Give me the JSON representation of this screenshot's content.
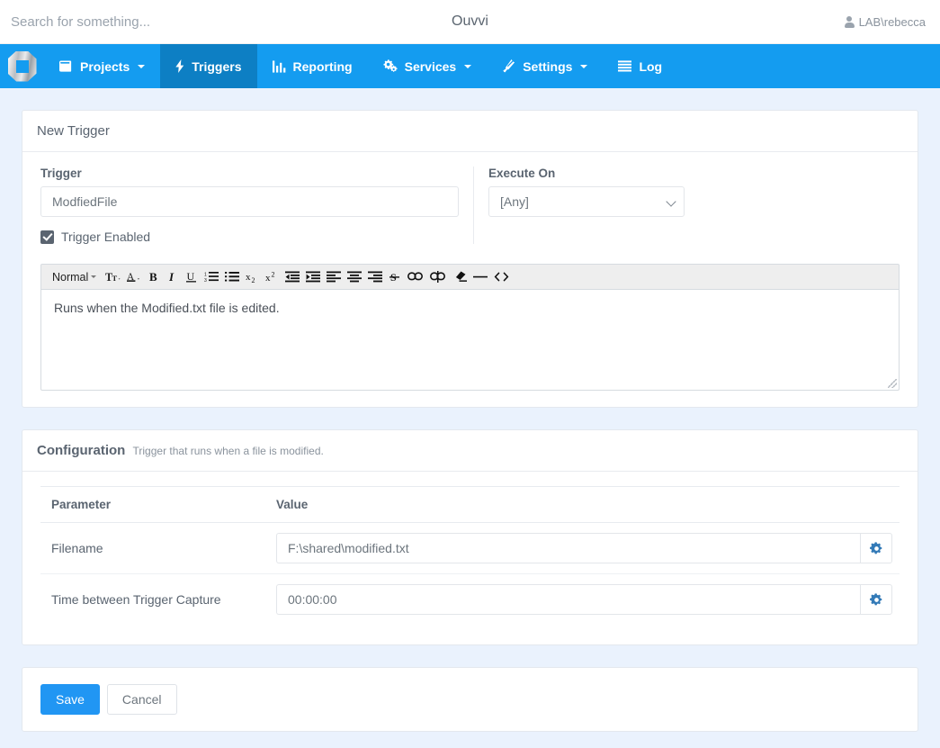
{
  "topbar": {
    "search_placeholder": "Search for something...",
    "search_value": "",
    "app_title": "Ouvvi",
    "user": "LAB\\rebecca"
  },
  "nav": {
    "brand_name": "ouvvi-logo",
    "items": [
      {
        "label": "Projects",
        "icon": "book-icon",
        "caret": true,
        "active": false
      },
      {
        "label": "Triggers",
        "icon": "bolt-icon",
        "caret": false,
        "active": true
      },
      {
        "label": "Reporting",
        "icon": "bar-chart-icon",
        "caret": false,
        "active": false
      },
      {
        "label": "Services",
        "icon": "gears-icon",
        "caret": true,
        "active": false
      },
      {
        "label": "Settings",
        "icon": "wrench-icon",
        "caret": true,
        "active": false
      },
      {
        "label": "Log",
        "icon": "list-icon",
        "caret": false,
        "active": false
      }
    ]
  },
  "trigger_panel": {
    "title": "New Trigger",
    "trigger_label": "Trigger",
    "trigger_value": "ModfiedFile",
    "trigger_placeholder": "",
    "execute_on_label": "Execute On",
    "execute_on_value": "[Any]",
    "execute_on_options": [
      "[Any]"
    ],
    "enabled_label": "Trigger Enabled",
    "enabled_checked": true
  },
  "editor": {
    "format_label": "Normal",
    "content": "Runs when the Modified.txt file is edited.",
    "tools": [
      {
        "name": "font-size-icon",
        "glyph": "Tᴛ"
      },
      {
        "name": "font-color-icon",
        "glyph": "A"
      },
      {
        "name": "bold-icon",
        "glyph": "B"
      },
      {
        "name": "italic-icon",
        "glyph": "I"
      },
      {
        "name": "underline-icon",
        "glyph": "U"
      },
      {
        "name": "ordered-list-icon",
        "glyph": ""
      },
      {
        "name": "unordered-list-icon",
        "glyph": ""
      },
      {
        "name": "subscript-icon",
        "glyph": "x₂"
      },
      {
        "name": "superscript-icon",
        "glyph": "x²"
      },
      {
        "name": "outdent-icon",
        "glyph": ""
      },
      {
        "name": "indent-icon",
        "glyph": ""
      },
      {
        "name": "align-left-icon",
        "glyph": ""
      },
      {
        "name": "align-center-icon",
        "glyph": ""
      },
      {
        "name": "align-right-icon",
        "glyph": ""
      },
      {
        "name": "strikethrough-icon",
        "glyph": "S"
      },
      {
        "name": "link-icon",
        "glyph": ""
      },
      {
        "name": "unlink-icon",
        "glyph": ""
      },
      {
        "name": "clear-format-icon",
        "glyph": ""
      },
      {
        "name": "horizontal-rule-icon",
        "glyph": "—"
      },
      {
        "name": "source-code-icon",
        "glyph": "<>"
      }
    ]
  },
  "configuration": {
    "title": "Configuration",
    "subtitle": "Trigger that runs when a file is modified.",
    "columns": [
      "Parameter",
      "Value"
    ],
    "rows": [
      {
        "parameter": "Filename",
        "value": "F:\\shared\\modified.txt",
        "action_icon": "gear-icon"
      },
      {
        "parameter": "Time between Trigger Capture",
        "value": "00:00:00",
        "action_icon": "gear-icon"
      }
    ]
  },
  "actions": {
    "save_label": "Save",
    "cancel_label": "Cancel"
  },
  "colors": {
    "nav_blue": "#149cf0",
    "nav_active_blue": "#0d7fc4",
    "primary_button": "#2196f3",
    "page_background": "#eaf2fd",
    "gear_blue": "#337ab7"
  }
}
